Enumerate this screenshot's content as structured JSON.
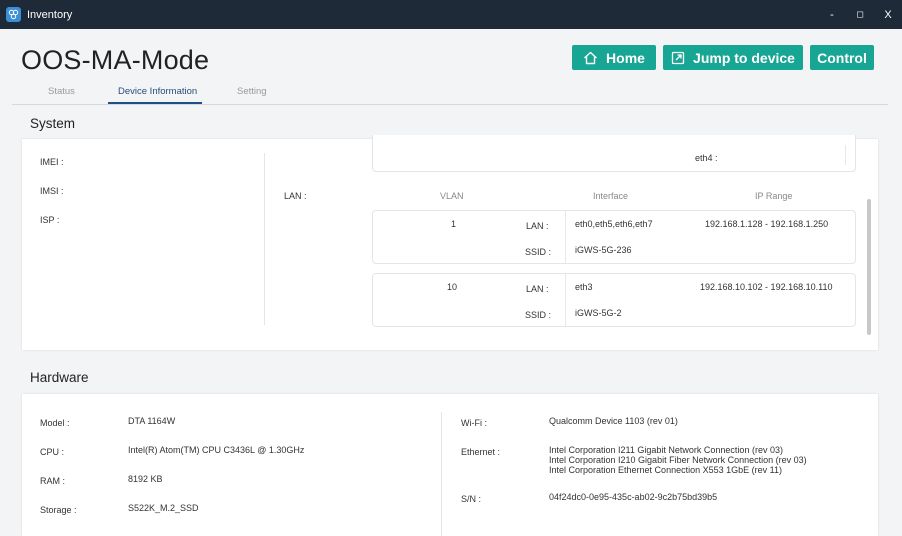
{
  "window": {
    "title": "Inventory",
    "min": "-",
    "max": "◻",
    "close": "X"
  },
  "header": {
    "title": "OOS-MA-Mode",
    "buttons": {
      "home": "Home",
      "jump": "Jump to device",
      "control": "Control"
    },
    "tabs": {
      "status": "Status",
      "device_info": "Device Information",
      "setting": "Setting"
    }
  },
  "system": {
    "title": "System",
    "imei_label": "IMEI :",
    "imsi_label": "IMSI :",
    "isp_label": "ISP :",
    "lan_label": "LAN :",
    "eth4_label": "eth4 :",
    "columns": {
      "vlan": "VLAN",
      "interface": "Interface",
      "ip_range": "IP Range"
    },
    "lan_entries": [
      {
        "vlan": "1",
        "lan_label": "LAN :",
        "lan": "eth0,eth5,eth6,eth7",
        "ip_range": "192.168.1.128 - 192.168.1.250",
        "ssid_label": "SSID :",
        "ssid": "iGWS-5G-236"
      },
      {
        "vlan": "10",
        "lan_label": "LAN :",
        "lan": "eth3",
        "ip_range": "192.168.10.102 - 192.168.10.110",
        "ssid_label": "SSID :",
        "ssid": "iGWS-5G-2"
      }
    ]
  },
  "hardware": {
    "title": "Hardware",
    "model_label": "Model :",
    "model": "DTA 1164W",
    "cpu_label": "CPU :",
    "cpu": "Intel(R) Atom(TM) CPU C3436L @ 1.30GHz",
    "ram_label": "RAM :",
    "ram": "8192 KB",
    "storage_label": "Storage :",
    "storage": "S522K_M.2_SSD",
    "wifi_label": "Wi-Fi :",
    "wifi": "Qualcomm Device 1103 (rev 01)",
    "ethernet_label": "Ethernet :",
    "ethernet": [
      "Intel Corporation I211 Gigabit Network Connection (rev 03)",
      "Intel Corporation I210 Gigabit Fiber Network Connection (rev 03)",
      "Intel Corporation Ethernet Connection X553 1GbE (rev 11)"
    ],
    "sn_label": "S/N :",
    "sn": "04f24dc0-0e95-435c-ab02-9c2b75bd39b5"
  }
}
